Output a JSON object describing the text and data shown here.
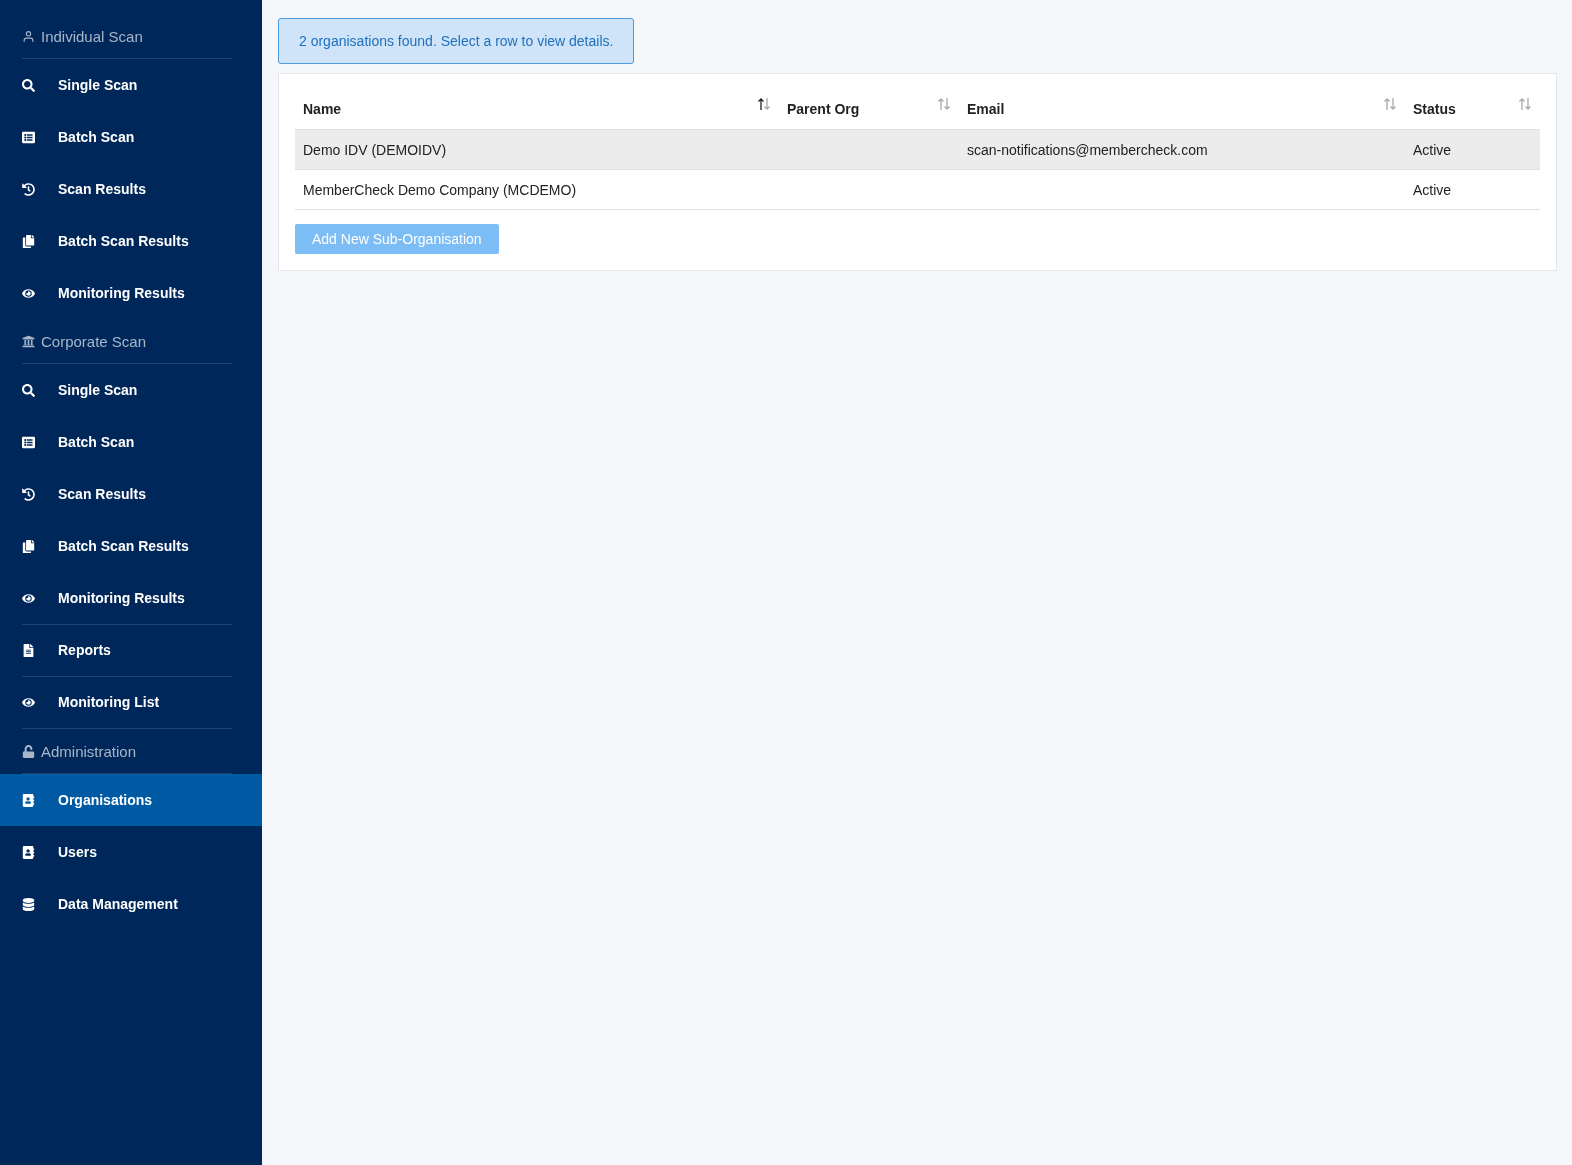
{
  "sidebar": {
    "sections": [
      {
        "kind": "group",
        "heading": "Individual Scan",
        "items": [
          {
            "label": "Single Scan",
            "selected": false
          },
          {
            "label": "Batch Scan",
            "selected": false
          },
          {
            "label": "Scan Results",
            "selected": false
          },
          {
            "label": "Batch Scan Results",
            "selected": false
          },
          {
            "label": "Monitoring Results",
            "selected": false
          }
        ]
      },
      {
        "kind": "group",
        "heading": "Corporate Scan",
        "items": [
          {
            "label": "Single Scan",
            "selected": false
          },
          {
            "label": "Batch Scan",
            "selected": false
          },
          {
            "label": "Scan Results",
            "selected": false
          },
          {
            "label": "Batch Scan Results",
            "selected": false
          },
          {
            "label": "Monitoring Results",
            "selected": false
          }
        ]
      },
      {
        "kind": "link",
        "items": [
          {
            "label": "Reports",
            "selected": false
          }
        ]
      },
      {
        "kind": "link",
        "items": [
          {
            "label": "Monitoring List",
            "selected": false
          }
        ]
      },
      {
        "kind": "group",
        "heading": "Administration",
        "items": [
          {
            "label": "Organisations",
            "selected": true
          },
          {
            "label": "Users",
            "selected": false
          },
          {
            "label": "Data Management",
            "selected": false
          }
        ]
      }
    ]
  },
  "alert": "2 organisations found. Select a row to view details.",
  "table": {
    "columns": [
      {
        "label": "Name",
        "sorted": true
      },
      {
        "label": "Parent Org",
        "sorted": false
      },
      {
        "label": "Email",
        "sorted": false
      },
      {
        "label": "Status",
        "sorted": false
      }
    ],
    "rows": [
      {
        "hovered": true,
        "cells": [
          "Demo IDV (DEMOIDV)",
          "",
          "scan-notifications@membercheck.com",
          "Active"
        ]
      },
      {
        "hovered": false,
        "cells": [
          "MemberCheck Demo Company (MCDEMO)",
          "",
          "",
          "Active"
        ]
      }
    ]
  },
  "add_button": "Add New Sub-Organisation"
}
